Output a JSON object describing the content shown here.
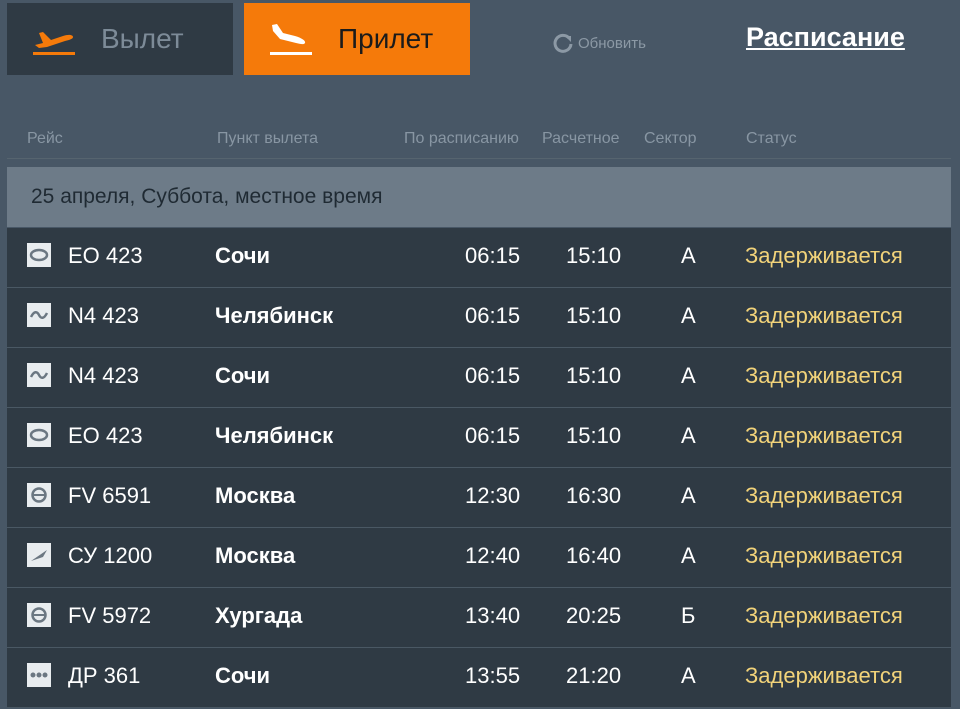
{
  "tabs": {
    "departures": {
      "label": "Вылет",
      "icon": "plane-takeoff-icon"
    },
    "arrivals": {
      "label": "Прилет",
      "icon": "plane-landing-icon",
      "active": true
    }
  },
  "refresh": {
    "label": "Обновить",
    "icon": "refresh-icon"
  },
  "schedule_link": "Расписание",
  "table": {
    "headers": {
      "flight": "Рейс",
      "origin": "Пункт вылета",
      "scheduled": "По расписанию",
      "estimated": "Расчетное",
      "sector": "Сектор",
      "status": "Статус"
    },
    "date_label": "25 апреля, Суббота, местное время",
    "rows": [
      {
        "logo": "airline-logo-eo",
        "flight": "ЕО 423",
        "city": "Сочи",
        "scheduled": "06:15",
        "estimated": "15:10",
        "sector": "А",
        "status": "Задерживается"
      },
      {
        "logo": "airline-logo-n4",
        "flight": "N4 423",
        "city": "Челябинск",
        "scheduled": "06:15",
        "estimated": "15:10",
        "sector": "А",
        "status": "Задерживается"
      },
      {
        "logo": "airline-logo-n4",
        "flight": "N4 423",
        "city": "Сочи",
        "scheduled": "06:15",
        "estimated": "15:10",
        "sector": "А",
        "status": "Задерживается"
      },
      {
        "logo": "airline-logo-eo",
        "flight": "ЕО 423",
        "city": "Челябинск",
        "scheduled": "06:15",
        "estimated": "15:10",
        "sector": "А",
        "status": "Задерживается"
      },
      {
        "logo": "airline-logo-fv",
        "flight": "FV 6591",
        "city": "Москва",
        "scheduled": "12:30",
        "estimated": "16:30",
        "sector": "А",
        "status": "Задерживается"
      },
      {
        "logo": "airline-logo-su",
        "flight": "СУ 1200",
        "city": "Москва",
        "scheduled": "12:40",
        "estimated": "16:40",
        "sector": "А",
        "status": "Задерживается"
      },
      {
        "logo": "airline-logo-fv",
        "flight": "FV 5972",
        "city": "Хургада",
        "scheduled": "13:40",
        "estimated": "20:25",
        "sector": "Б",
        "status": "Задерживается"
      },
      {
        "logo": "airline-logo-dp",
        "flight": "ДР 361",
        "city": "Сочи",
        "scheduled": "13:55",
        "estimated": "21:20",
        "sector": "А",
        "status": "Задерживается"
      }
    ]
  },
  "colors": {
    "background": "#485766",
    "tab_inactive": "#2f3a44",
    "tab_active": "#f57a0a",
    "row_background": "#2f3a44",
    "date_bar": "#6d7b88",
    "status_delayed": "#f2d37a"
  }
}
